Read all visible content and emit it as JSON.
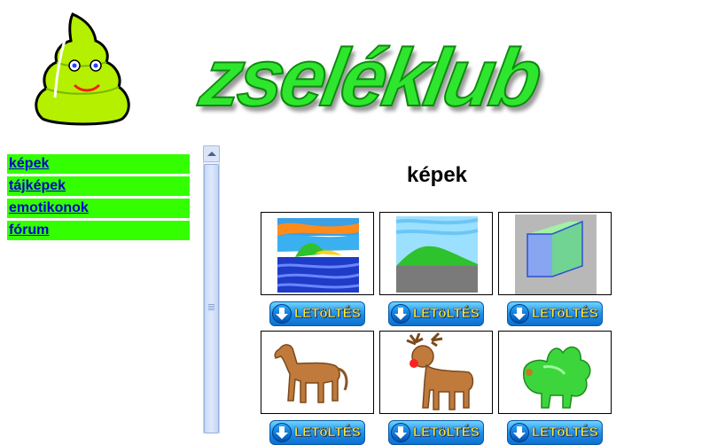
{
  "header": {
    "logo_text": "zseléklub"
  },
  "nav": {
    "items": [
      {
        "label": "képek"
      },
      {
        "label": "tájképek"
      },
      {
        "label": "emotikonok"
      },
      {
        "label": "fórum"
      }
    ]
  },
  "main": {
    "title": "képek",
    "download_label": "LETöLTÉS",
    "gallery": [
      {
        "icon": "colorful-landscape-painting"
      },
      {
        "icon": "green-hill-landscape"
      },
      {
        "icon": "3d-glass-cube"
      },
      {
        "icon": "brown-horse-figure"
      },
      {
        "icon": "reindeer-figure"
      },
      {
        "icon": "green-jelly-creature"
      }
    ]
  },
  "colors": {
    "nav_background": "#33ff00",
    "link": "#0000cc",
    "logo_green": "#2ee62e"
  }
}
